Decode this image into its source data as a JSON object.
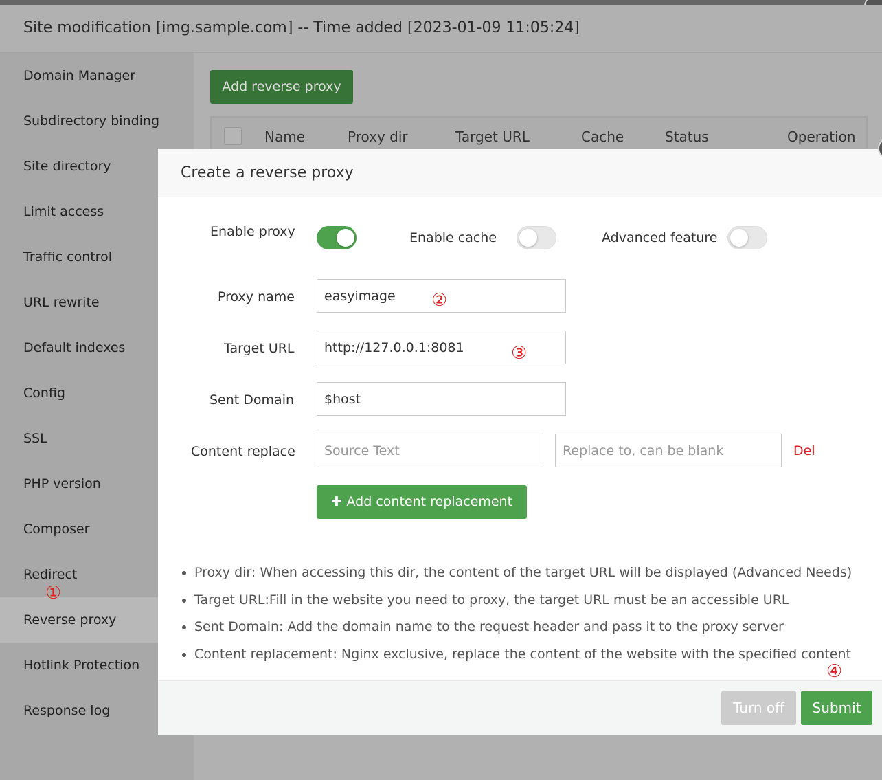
{
  "window": {
    "title": "Site modification [img.sample.com] -- Time added [2023-01-09 11:05:24]"
  },
  "sidebar": {
    "items": [
      {
        "label": "Domain Manager"
      },
      {
        "label": "Subdirectory binding"
      },
      {
        "label": "Site directory"
      },
      {
        "label": "Limit access"
      },
      {
        "label": "Traffic control"
      },
      {
        "label": "URL rewrite"
      },
      {
        "label": "Default indexes"
      },
      {
        "label": "Config"
      },
      {
        "label": "SSL"
      },
      {
        "label": "PHP version"
      },
      {
        "label": "Composer"
      },
      {
        "label": "Redirect"
      },
      {
        "label": "Reverse proxy",
        "active": true
      },
      {
        "label": "Hotlink Protection"
      },
      {
        "label": "Response log"
      }
    ]
  },
  "main": {
    "add_button": "Add reverse proxy",
    "columns": [
      "Name",
      "Proxy dir",
      "Target URL",
      "Cache",
      "Status",
      "Operation"
    ]
  },
  "modal": {
    "title": "Create a reverse proxy",
    "enable_proxy": {
      "label": "Enable proxy",
      "on": true
    },
    "enable_cache": {
      "label": "Enable cache",
      "on": false
    },
    "advanced": {
      "label": "Advanced feature",
      "on": false
    },
    "proxy_name": {
      "label": "Proxy name",
      "value": "easyimage"
    },
    "target_url": {
      "label": "Target URL",
      "value": "http://127.0.0.1:8081"
    },
    "sent_domain": {
      "label": "Sent Domain",
      "value": "$host"
    },
    "content_replace": {
      "label": "Content replace",
      "source_placeholder": "Source Text",
      "replace_placeholder": "Replace to, can be blank",
      "del": "Del"
    },
    "add_replacement": "Add content replacement",
    "notes": [
      "Proxy dir: When accessing this dir, the content of the target URL will be displayed (Advanced Needs)",
      "Target URL:Fill in the website you need to proxy, the target URL must be an accessible URL",
      "Sent Domain: Add the domain name to the request header and pass it to the proxy server",
      "Content replacement: Nginx exclusive, replace the content of the website with the specified content"
    ],
    "turn_off": "Turn off",
    "submit": "Submit"
  },
  "annotations": [
    "①",
    "②",
    "③",
    "④"
  ],
  "colors": {
    "accent": "#4ea24d",
    "danger": "#e02020"
  }
}
